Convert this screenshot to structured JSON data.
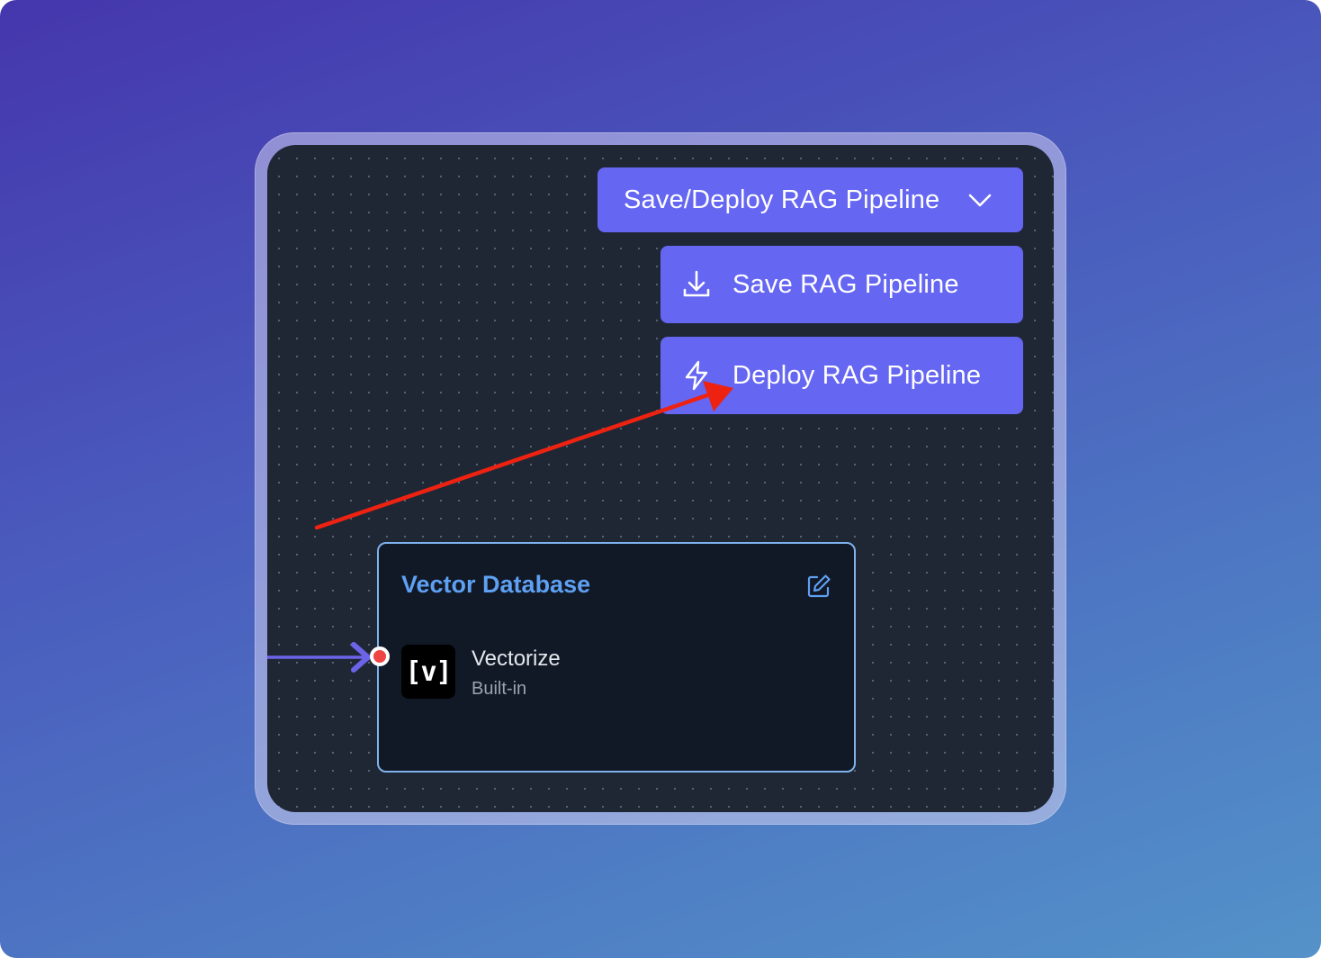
{
  "menu": {
    "main_label": "Save/Deploy RAG Pipeline",
    "save_label": "Save RAG Pipeline",
    "deploy_label": "Deploy RAG Pipeline",
    "main_icon": "chevron-down-icon",
    "save_icon": "download-icon",
    "deploy_icon": "lightning-bolt-icon"
  },
  "node": {
    "title": "Vector Database",
    "edit_icon": "edit-icon",
    "item": {
      "logo_text": "[v]",
      "name": "Vectorize",
      "subtitle": "Built-in"
    }
  },
  "colors": {
    "button": "#6566f1",
    "canvas": "#1f2735",
    "node_border": "#7fb2ec",
    "node_title": "#5ea0f2",
    "annotation_arrow": "#ee2211",
    "edge": "#6b63e8",
    "port": "#ef4444"
  }
}
